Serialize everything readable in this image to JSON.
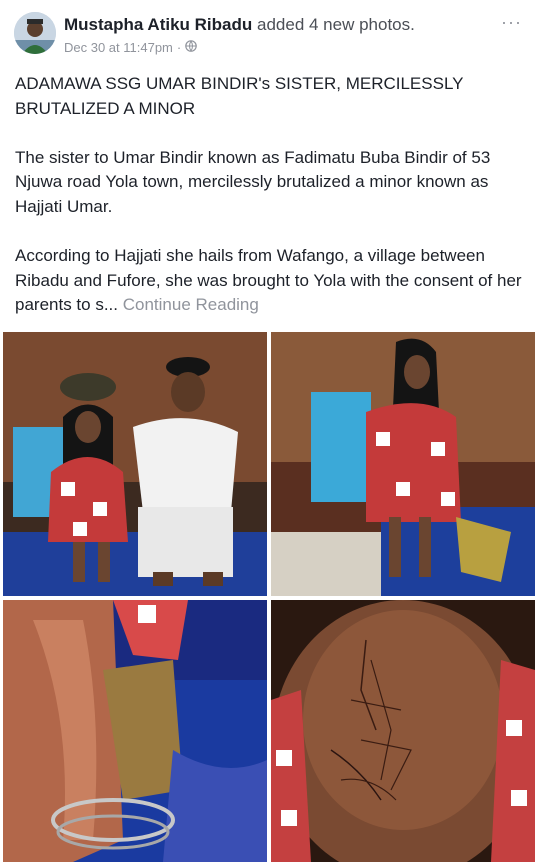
{
  "post": {
    "author": "Mustapha Atiku Ribadu",
    "action": "added 4 new photos.",
    "timestamp": "Dec 30 at 11:47pm",
    "separator": "·",
    "privacy_icon": "globe-icon",
    "more_icon": "more-options-icon",
    "more_label": "···"
  },
  "content": {
    "title": "ADAMAWA SSG UMAR BINDIR's SISTER, MERCILESSLY BRUTALIZED A MINOR",
    "paragraph1": "The sister to Umar Bindir known as Fadimatu Buba Bindir of 53 Njuwa road Yola town, mercilessly brutalized a minor known as Hajjati Umar.",
    "paragraph2": "According to Hajjati she hails from Wafango, a village between Ribadu and Fufore,  she was brought to Yola with the consent of her parents to s...",
    "continue_label": "Continue Reading"
  },
  "photos": [
    {
      "name": "photo-girl-and-man-seated"
    },
    {
      "name": "photo-girl-seated-alone"
    },
    {
      "name": "photo-injured-arm"
    },
    {
      "name": "photo-scarred-back"
    }
  ],
  "colors": {
    "text": "#1d2129",
    "muted": "#90949c",
    "link": "#90949c"
  }
}
